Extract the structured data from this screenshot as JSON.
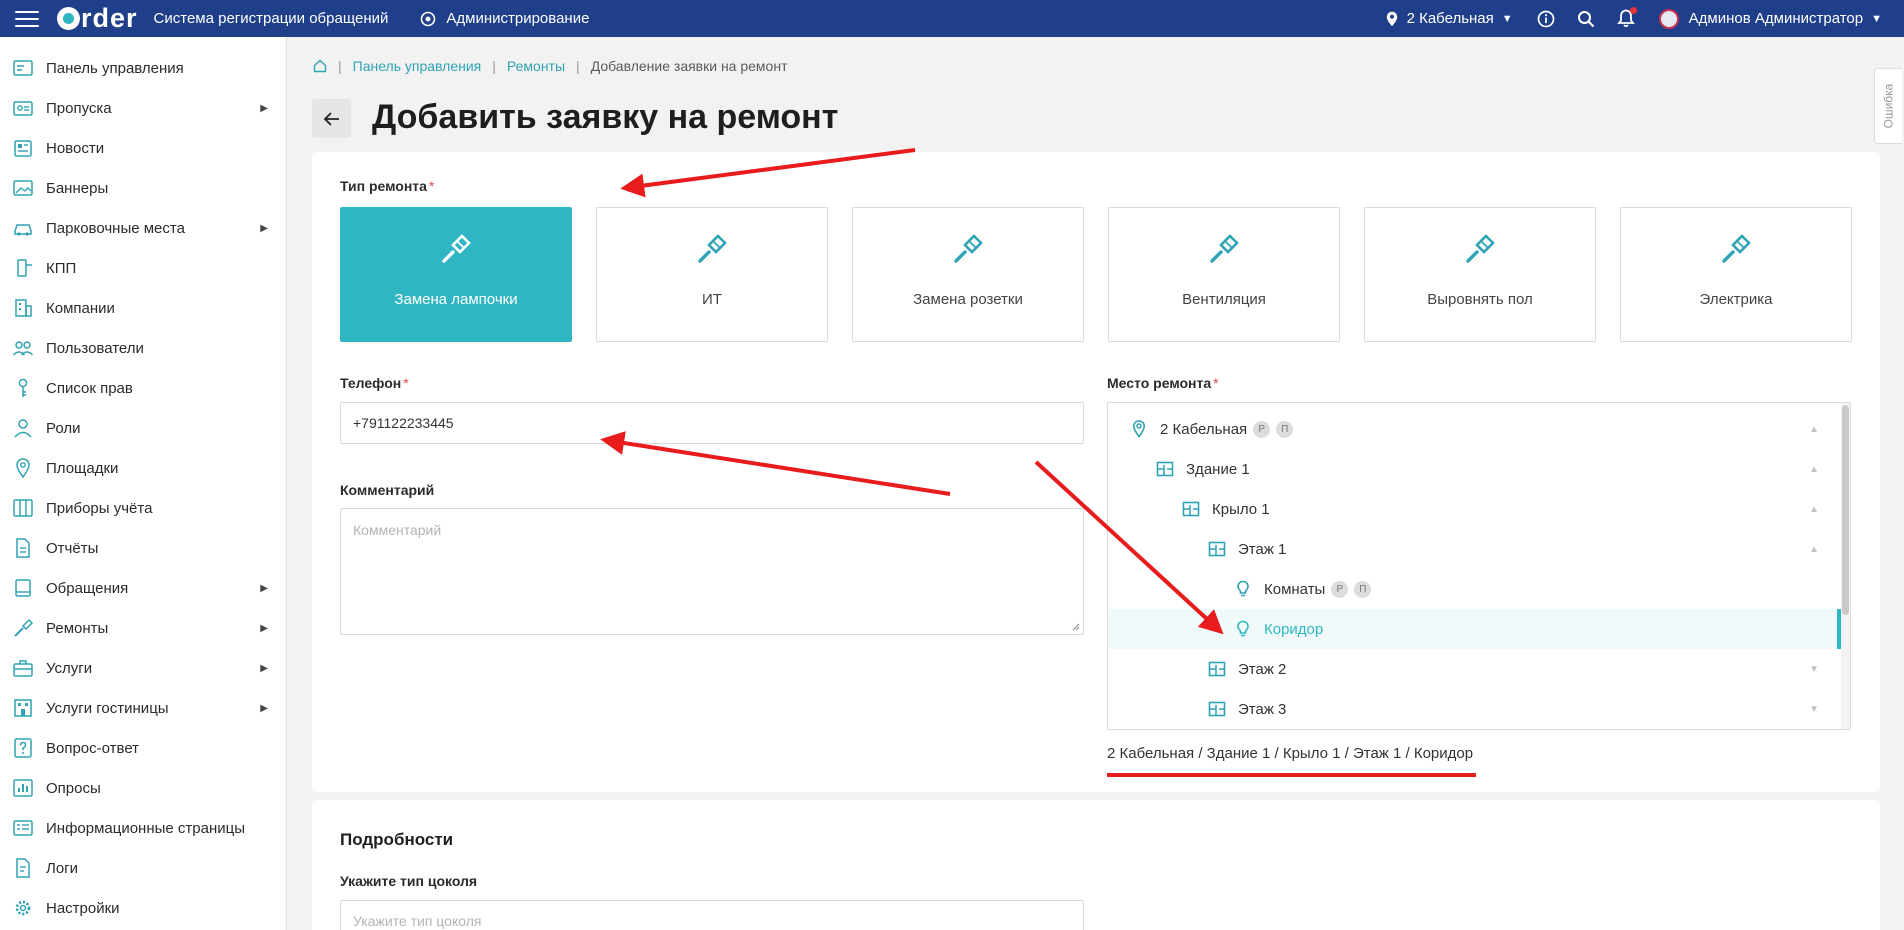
{
  "topbar": {
    "logo_text": "rder",
    "app_title": "Система регистрации обращений",
    "admin_label": "Администрирование",
    "location": "2 Кабельная",
    "user_name": "Админов Администратор"
  },
  "sidebar": {
    "items": [
      {
        "label": "Панель управления",
        "icon": "dashboard-icon",
        "has_submenu": false
      },
      {
        "label": "Пропуска",
        "icon": "pass-card-icon",
        "has_submenu": true
      },
      {
        "label": "Новости",
        "icon": "news-icon",
        "has_submenu": false
      },
      {
        "label": "Баннеры",
        "icon": "image-icon",
        "has_submenu": false
      },
      {
        "label": "Парковочные места",
        "icon": "car-icon",
        "has_submenu": true
      },
      {
        "label": "КПП",
        "icon": "checkpoint-icon",
        "has_submenu": false
      },
      {
        "label": "Компании",
        "icon": "building-icon",
        "has_submenu": false
      },
      {
        "label": "Пользователи",
        "icon": "users-icon",
        "has_submenu": false
      },
      {
        "label": "Список прав",
        "icon": "key-icon",
        "has_submenu": false
      },
      {
        "label": "Роли",
        "icon": "user-icon",
        "has_submenu": false
      },
      {
        "label": "Площадки",
        "icon": "map-pin-icon",
        "has_submenu": false
      },
      {
        "label": "Приборы учёта",
        "icon": "meter-icon",
        "has_submenu": false
      },
      {
        "label": "Отчёты",
        "icon": "report-icon",
        "has_submenu": false
      },
      {
        "label": "Обращения",
        "icon": "book-icon",
        "has_submenu": true
      },
      {
        "label": "Ремонты",
        "icon": "screwdriver-icon",
        "has_submenu": true
      },
      {
        "label": "Услуги",
        "icon": "briefcase-icon",
        "has_submenu": true
      },
      {
        "label": "Услуги гостиницы",
        "icon": "hotel-icon",
        "has_submenu": true
      },
      {
        "label": "Вопрос-ответ",
        "icon": "question-icon",
        "has_submenu": false
      },
      {
        "label": "Опросы",
        "icon": "poll-icon",
        "has_submenu": false
      },
      {
        "label": "Информационные страницы",
        "icon": "info-page-icon",
        "has_submenu": false
      },
      {
        "label": "Логи",
        "icon": "log-icon",
        "has_submenu": false
      },
      {
        "label": "Настройки",
        "icon": "gear-icon",
        "has_submenu": false
      }
    ]
  },
  "breadcrumb": {
    "items": [
      "Панель управления",
      "Ремонты",
      "Добавление заявки на ремонт"
    ]
  },
  "page": {
    "title": "Добавить заявку на ремонт"
  },
  "form": {
    "repair_type_label": "Тип ремонта",
    "required_mark": "*",
    "repair_types": [
      {
        "label": "Замена лампочки",
        "selected": true
      },
      {
        "label": "ИТ",
        "selected": false
      },
      {
        "label": "Замена розетки",
        "selected": false
      },
      {
        "label": "Вентиляция",
        "selected": false
      },
      {
        "label": "Выровнять пол",
        "selected": false
      },
      {
        "label": "Электрика",
        "selected": false
      }
    ],
    "phone_label": "Телефон",
    "phone_value": "+791122233445",
    "comment_label": "Комментарий",
    "comment_placeholder": "Комментарий",
    "location_label": "Место ремонта",
    "tree": [
      {
        "label": "2 Кабельная",
        "kind": "site",
        "badges": [
          "Р",
          "П"
        ],
        "expand": "up",
        "selected": false
      },
      {
        "label": "Здание 1",
        "kind": "building",
        "badges": [],
        "expand": "up",
        "selected": false
      },
      {
        "label": "Крыло 1",
        "kind": "building",
        "badges": [],
        "expand": "up",
        "selected": false
      },
      {
        "label": "Этаж 1",
        "kind": "building",
        "badges": [],
        "expand": "up",
        "selected": false
      },
      {
        "label": "Комнаты",
        "kind": "bulb",
        "badges": [
          "Р",
          "П"
        ],
        "expand": "",
        "selected": false
      },
      {
        "label": "Коридор",
        "kind": "bulb",
        "badges": [],
        "expand": "",
        "selected": true
      },
      {
        "label": "Этаж 2",
        "kind": "building",
        "badges": [],
        "expand": "down",
        "selected": false
      },
      {
        "label": "Этаж 3",
        "kind": "building",
        "badges": [],
        "expand": "down",
        "selected": false
      }
    ],
    "selected_path": "2 Кабельная / Здание 1 / Крыло 1 / Этаж 1 / Коридор"
  },
  "details": {
    "title": "Подробности",
    "socket_label": "Укажите тип цоколя",
    "socket_placeholder": "Укажите тип цоколя"
  },
  "error_tab": {
    "label": "Ошибка"
  },
  "colors": {
    "header": "#1f3f8a",
    "accent": "#2fb6c2",
    "annotation": "#e81c1c"
  }
}
